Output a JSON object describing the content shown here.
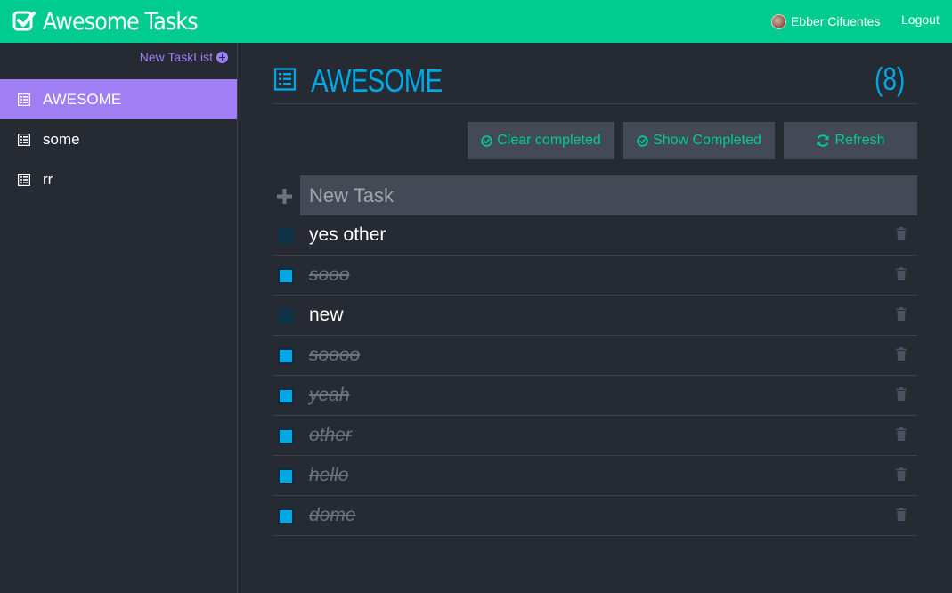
{
  "app": {
    "title": "Awesome Tasks"
  },
  "header": {
    "user_name": "Ebber Cifuentes",
    "logout_label": "Logout"
  },
  "sidebar": {
    "new_tasklist_label": "New TaskList",
    "items": [
      {
        "label": "AWESOME",
        "active": true
      },
      {
        "label": "some",
        "active": false
      },
      {
        "label": "rr",
        "active": false
      }
    ]
  },
  "main": {
    "title": "AWESOME",
    "count": "(8)",
    "buttons": {
      "clear_completed": "Clear completed",
      "show_completed": "Show Completed",
      "refresh": "Refresh"
    },
    "new_task_placeholder": "New Task",
    "tasks": [
      {
        "text": "yes other",
        "done": false
      },
      {
        "text": "sooo",
        "done": true
      },
      {
        "text": "new",
        "done": false
      },
      {
        "text": "soooo",
        "done": true
      },
      {
        "text": "yeah",
        "done": true
      },
      {
        "text": "other",
        "done": true
      },
      {
        "text": "hello",
        "done": true
      },
      {
        "text": "dome",
        "done": true
      }
    ]
  },
  "colors": {
    "header": "#00cc8f",
    "accent_purple": "#a07ff5",
    "accent_blue": "#00a7e5",
    "background": "#252a33",
    "panel": "#434a56"
  },
  "icons": {
    "brand": "check-square-icon",
    "list": "list-icon",
    "add": "plus-icon",
    "delete": "trash-icon",
    "clear": "check-circle-icon",
    "show": "check-circle-icon",
    "refresh": "refresh-icon"
  }
}
